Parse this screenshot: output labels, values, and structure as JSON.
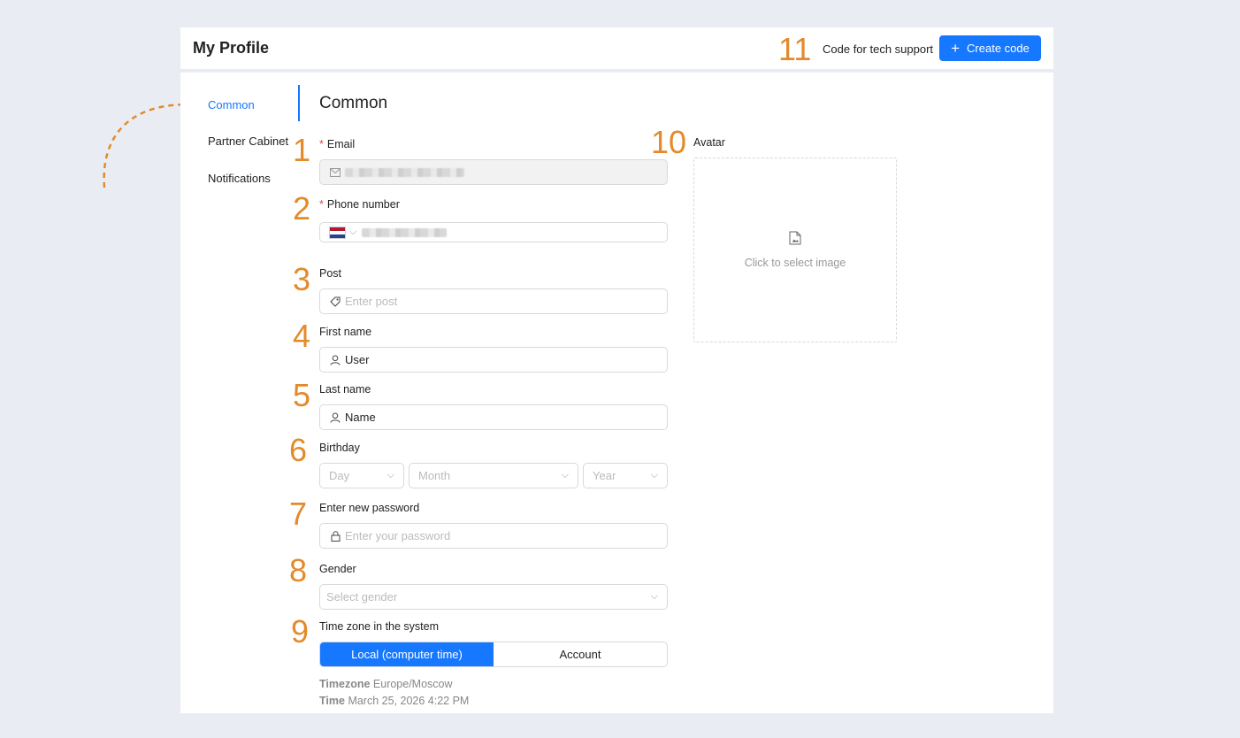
{
  "header": {
    "title": "My Profile",
    "support_text": "Code for tech support",
    "create_button": "Create code"
  },
  "sidebar": {
    "items": [
      {
        "label": "Common",
        "active": true
      },
      {
        "label": "Partner Cabinet",
        "active": false
      },
      {
        "label": "Notifications",
        "active": false
      }
    ]
  },
  "section": {
    "title": "Common"
  },
  "form": {
    "email": {
      "label": "Email",
      "required": true
    },
    "phone": {
      "label": "Phone number",
      "required": true
    },
    "post": {
      "label": "Post",
      "placeholder": "Enter post"
    },
    "first_name": {
      "label": "First name",
      "value": "User"
    },
    "last_name": {
      "label": "Last name",
      "value": "Name"
    },
    "birthday": {
      "label": "Birthday",
      "day": "Day",
      "month": "Month",
      "year": "Year"
    },
    "password": {
      "label": "Enter new password",
      "placeholder": "Enter your password"
    },
    "gender": {
      "label": "Gender",
      "placeholder": "Select gender"
    },
    "timezone": {
      "label": "Time zone in the system",
      "options": [
        "Local (computer time)",
        "Account"
      ],
      "selected": "Local (computer time)",
      "tz_key": "Timezone",
      "tz_value": "Europe/Moscow",
      "time_key": "Time",
      "time_value": "March 25, 2026 4:22 PM"
    }
  },
  "avatar": {
    "label": "Avatar",
    "hint": "Click to select image"
  },
  "annotations": [
    "1",
    "2",
    "3",
    "4",
    "5",
    "6",
    "7",
    "8",
    "9",
    "10",
    "11"
  ],
  "colors": {
    "accent": "#1677ff",
    "annotation": "#e38a2b",
    "background": "#e9edf3",
    "required": "#e5484d"
  }
}
